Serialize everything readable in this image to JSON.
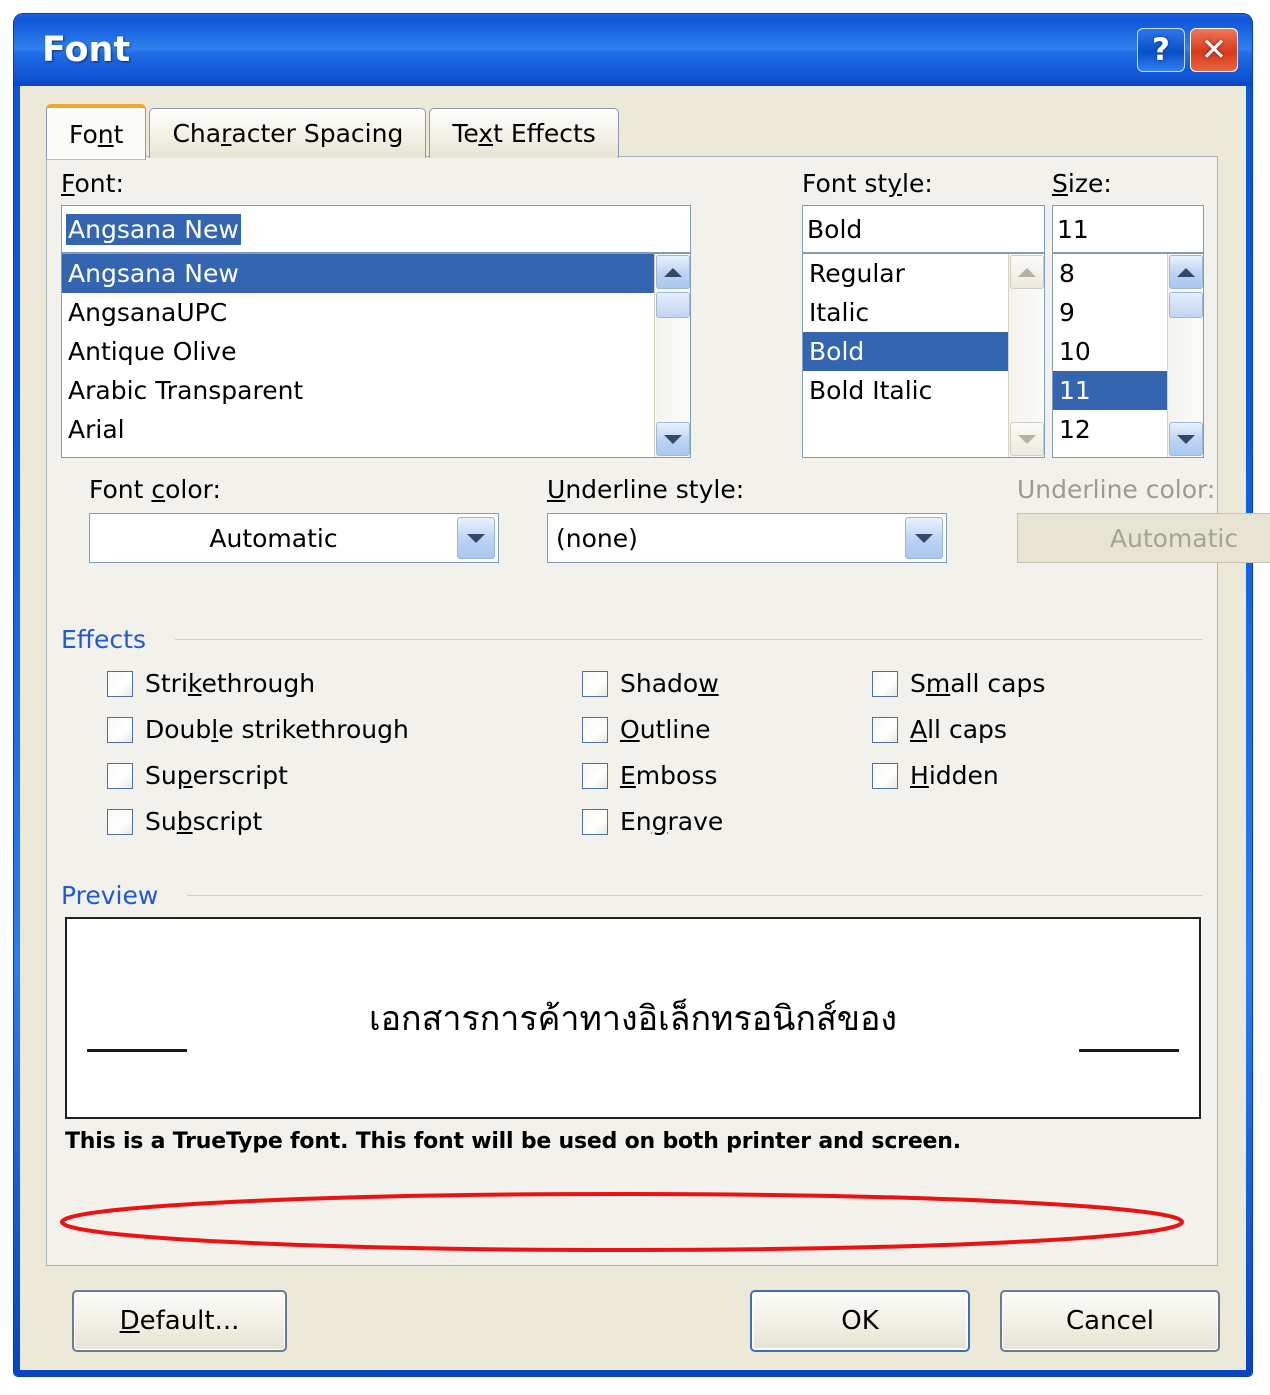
{
  "window": {
    "title": "Font",
    "buttons": [
      {
        "name": "help-button",
        "glyph": "?"
      },
      {
        "name": "close-button",
        "glyph": "✕"
      }
    ]
  },
  "tabs": [
    {
      "label": "Font",
      "accel": "n",
      "active": true
    },
    {
      "label": "Character Spacing",
      "accel": "r",
      "active": false
    },
    {
      "label": "Text Effects",
      "accel": "x",
      "active": false
    }
  ],
  "font_section": {
    "font_label": "Font:",
    "font_label_accel": "F",
    "font_value": "Angsana New",
    "font_items": [
      "Angsana New",
      "AngsanaUPC",
      "Antique Olive",
      "Arabic Transparent",
      "Arial"
    ],
    "font_selected_index": 0,
    "style_label": "Font style:",
    "style_label_accel": "y",
    "style_value": "Bold",
    "style_items": [
      "Regular",
      "Italic",
      "Bold",
      "Bold Italic"
    ],
    "style_selected_index": 2,
    "size_label": "Size:",
    "size_label_accel": "S",
    "size_value": "11",
    "size_items": [
      "8",
      "9",
      "10",
      "11",
      "12"
    ],
    "size_selected_index": 3
  },
  "color_row": {
    "font_color_label": "Font color:",
    "font_color_accel": "c",
    "font_color_value": "Automatic",
    "underline_style_label": "Underline style:",
    "underline_style_accel": "U",
    "underline_style_value": "(none)",
    "underline_color_label": "Underline color:",
    "underline_color_value": "Automatic",
    "underline_color_disabled": true
  },
  "effects": {
    "group_label": "Effects",
    "column1": [
      {
        "label": "Strikethrough",
        "accel": "k",
        "checked": false
      },
      {
        "label": "Double strikethrough",
        "accel": "l",
        "checked": false
      },
      {
        "label": "Superscript",
        "accel": "p",
        "checked": false
      },
      {
        "label": "Subscript",
        "accel": "b",
        "checked": false
      }
    ],
    "column2": [
      {
        "label": "Shadow",
        "accel": "w",
        "checked": false
      },
      {
        "label": "Outline",
        "accel": "O",
        "checked": false
      },
      {
        "label": "Emboss",
        "accel": "E",
        "checked": false
      },
      {
        "label": "Engrave",
        "accel": "g",
        "checked": false
      }
    ],
    "column3": [
      {
        "label": "Small caps",
        "accel": "m",
        "checked": false
      },
      {
        "label": "All caps",
        "accel": "A",
        "checked": false
      },
      {
        "label": "Hidden",
        "accel": "H",
        "checked": false
      }
    ]
  },
  "preview": {
    "group_label": "Preview",
    "sample_text": "เอกสารการค้าทางอิเล็กทรอนิกส์ของ",
    "note": "This is a TrueType font. This font will be used on both printer and screen."
  },
  "footer": {
    "default_label": "Default...",
    "default_accel": "D",
    "ok_label": "OK",
    "cancel_label": "Cancel"
  },
  "colors": {
    "titlebar_blue": "#0b5bdf",
    "selection_blue": "#3465b0",
    "group_label_blue": "#1f5bd0",
    "dialog_face": "#ece9d8",
    "tab_page_face": "#f2f1eb",
    "annotation_red": "#ee1111",
    "active_tab_accent": "#f0a830"
  }
}
